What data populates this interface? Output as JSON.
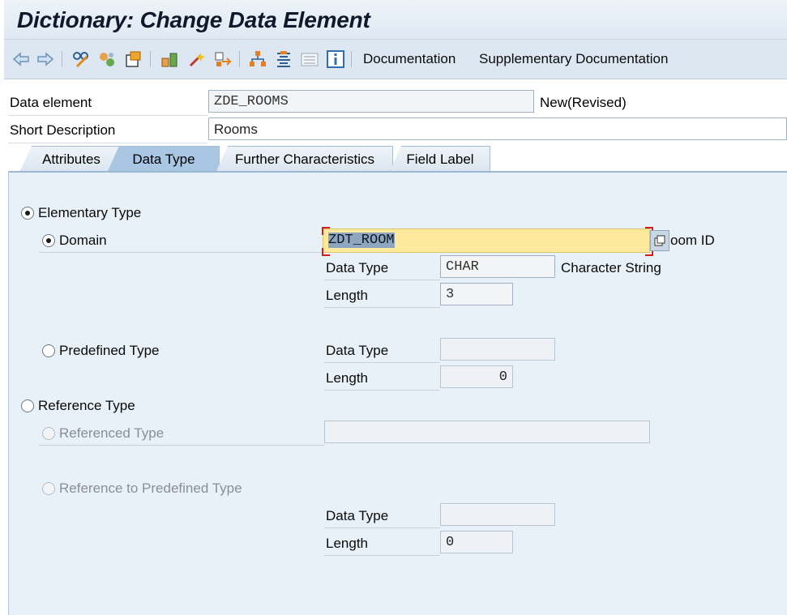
{
  "window": {
    "title": "Dictionary: Change Data Element"
  },
  "toolbar": {
    "icons": [
      "back-arrow-icon",
      "forward-arrow-icon",
      "display-change-icon",
      "other-object-icon",
      "activate-icon",
      "check-icon",
      "where-used-icon",
      "test-icon",
      "move-icon",
      "hierarchy-icon",
      "indent-icon",
      "list-icon",
      "info-icon"
    ],
    "documentation_label": "Documentation",
    "supplementary_label": "Supplementary Documentation"
  },
  "header": {
    "data_element_label": "Data element",
    "data_element_value": "ZDE_ROOMS",
    "status": "New(Revised)",
    "short_description_label": "Short Description",
    "short_description_value": "Rooms"
  },
  "tabs": [
    {
      "label": "Attributes",
      "active": false
    },
    {
      "label": "Data Type",
      "active": true
    },
    {
      "label": "Further Characteristics",
      "active": false
    },
    {
      "label": "Field Label",
      "active": false
    }
  ],
  "data_type_tab": {
    "elementary_type_label": "Elementary Type",
    "domain": {
      "label": "Domain",
      "value": "ZDT_ROOM",
      "description_visible": "oom ID",
      "data_type_label": "Data Type",
      "data_type_value": "CHAR",
      "data_type_text": "Character String",
      "length_label": "Length",
      "length_value": "3"
    },
    "predefined": {
      "label": "Predefined Type",
      "data_type_label": "Data Type",
      "data_type_value": "",
      "length_label": "Length",
      "length_value": "0"
    },
    "reference_type_label": "Reference Type",
    "referenced_type": {
      "label": "Referenced Type",
      "value": ""
    },
    "reference_predefined": {
      "label": "Reference to Predefined Type",
      "data_type_label": "Data Type",
      "data_type_value": "",
      "length_label": "Length",
      "length_value": "0"
    },
    "selected_radio": "domain"
  }
}
